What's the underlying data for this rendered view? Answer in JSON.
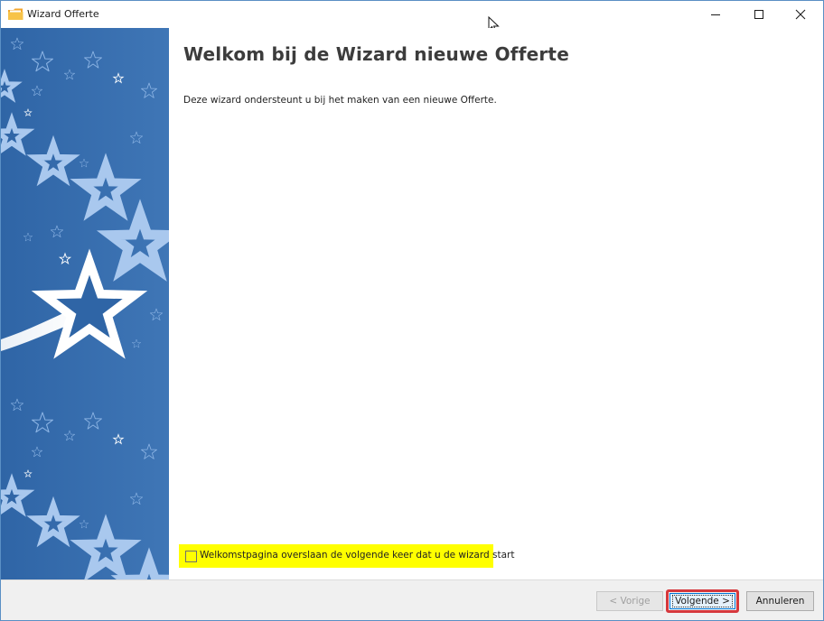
{
  "window": {
    "title": "Wizard Offerte",
    "controls": {
      "minimize": "minimize-icon",
      "maximize": "maximize-icon",
      "close": "close-icon"
    }
  },
  "content": {
    "heading": "Welkom bij de Wizard nieuwe Offerte",
    "description": "Deze wizard ondersteunt u bij het maken van een nieuwe Offerte.",
    "skip_checkbox": {
      "label": "Welkomstpagina overslaan de volgende keer dat u de wizard start",
      "checked": false
    }
  },
  "footer": {
    "prev_label": "< Vorige",
    "next_label": "Volgende >",
    "cancel_label": "Annuleren"
  },
  "colors": {
    "sidebar_blue": "#3a70b0",
    "highlight_yellow": "#ffff00",
    "next_button_outline": "#d6383d"
  }
}
